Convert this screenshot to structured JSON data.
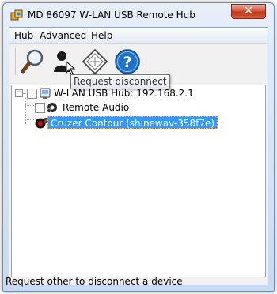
{
  "window": {
    "title": "MD 86097 W-LAN USB Remote Hub"
  },
  "menu": {
    "items": [
      "Hub",
      "Advanced",
      "Help"
    ]
  },
  "toolbar": {
    "buttons": [
      {
        "name": "search",
        "icon": "magnifier-icon"
      },
      {
        "name": "request-disconnect",
        "icon": "person-icon"
      },
      {
        "name": "auto-connect",
        "icon": "diamond-icon"
      },
      {
        "name": "help",
        "icon": "help-icon"
      }
    ]
  },
  "tooltip": {
    "text": "Request disconnect"
  },
  "tree": {
    "root": {
      "label": "W-LAN USB Hub: 192.168.2.1",
      "expander": "−"
    },
    "children": [
      {
        "label": "Remote Audio",
        "icon": "audio-device-icon"
      },
      {
        "label": "Cruzer Contour (shinewav-358f7e)",
        "icon": "usb-device-icon",
        "selected": true
      }
    ]
  },
  "statusbar": {
    "text": "Request other to disconnect a device"
  },
  "colors": {
    "selection": "#3399ff",
    "close_button": "#c0391a",
    "help_blue": "#1e73c8"
  }
}
